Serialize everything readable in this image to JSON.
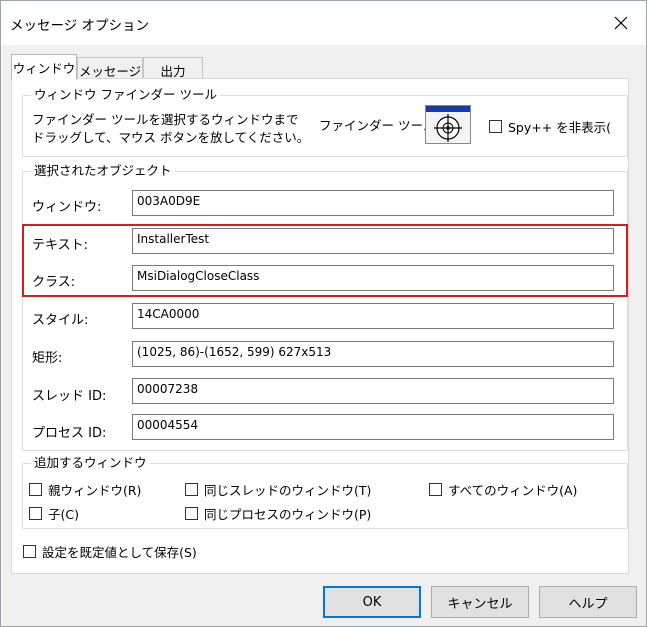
{
  "window": {
    "title": "メッセージ オプション"
  },
  "tabs": [
    "ウィンドウ",
    "メッセージ",
    "出力"
  ],
  "finder_group": {
    "title": "ウィンドウ ファインダー ツール",
    "instruction_line1": "ファインダー ツールを選択するウィンドウまで",
    "instruction_line2": "ドラッグして、マウス ボタンを放してください。",
    "tool_label": "ファインダー ツール:",
    "hide_spy_label": "Spy++ を非表示("
  },
  "selected_object": {
    "title": "選択されたオブジェクト",
    "window_label": "ウィンドウ:",
    "window_value": "003A0D9E",
    "text_label": "テキスト:",
    "text_value": "InstallerTest",
    "class_label": "クラス:",
    "class_value": "MsiDialogCloseClass",
    "style_label": "スタイル:",
    "style_value": "14CA0000",
    "rect_label": "矩形:",
    "rect_value": "(1025, 86)-(1652, 599) 627x513",
    "thread_label": "スレッド ID:",
    "thread_value": "00007238",
    "process_label": "プロセス ID:",
    "process_value": "00004554"
  },
  "additional": {
    "title": "追加するウィンドウ",
    "parent": "親ウィンドウ(R)",
    "child": "子(C)",
    "same_thread": "同じスレッドのウィンドウ(T)",
    "same_process": "同じプロセスのウィンドウ(P)",
    "all": "すべてのウィンドウ(A)"
  },
  "save_default": "設定を既定値として保存(S)",
  "buttons": {
    "ok": "OK",
    "cancel": "キャンセル",
    "help": "ヘルプ"
  },
  "colors": {
    "highlight": "#d11f1f",
    "default_button_border": "#0078d7"
  }
}
